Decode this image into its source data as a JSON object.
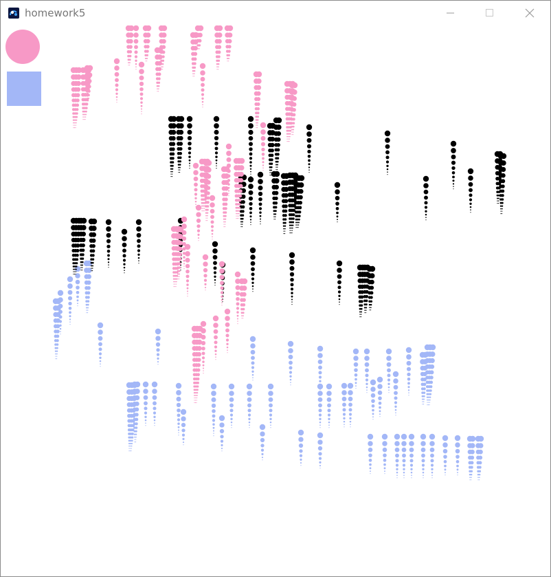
{
  "window": {
    "title": "homework5",
    "icon": "processing-app-icon",
    "controls": [
      "minimize-icon",
      "maximize-icon",
      "close-icon"
    ]
  },
  "palette": {
    "pink": "#f799c6",
    "blue": "#a3b7f7",
    "black": "#000000",
    "background": "#ffffff",
    "ui_gray": "#9a9a9a"
  },
  "sketch": {
    "pink_drips": [
      [
        186,
        40,
        9,
        1
      ],
      [
        197,
        40,
        10,
        0
      ],
      [
        211,
        40,
        8,
        1
      ],
      [
        234,
        40,
        10,
        1
      ],
      [
        287,
        40,
        5,
        1
      ],
      [
        315,
        40,
        10,
        1
      ],
      [
        330,
        40,
        8,
        1
      ],
      [
        280,
        50,
        10,
        1
      ],
      [
        228,
        72,
        10,
        1
      ],
      [
        169,
        88,
        10,
        0
      ],
      [
        106,
        101,
        14,
        2
      ],
      [
        120,
        101,
        12,
        2
      ],
      [
        126,
        98,
        8,
        1
      ],
      [
        205,
        93,
        12,
        0
      ],
      [
        294,
        95,
        10,
        0
      ],
      [
        372,
        107,
        13,
        1
      ],
      [
        417,
        121,
        14,
        2
      ],
      [
        424,
        123,
        12,
        1
      ],
      [
        382,
        181,
        11,
        0
      ],
      [
        332,
        212,
        12,
        0
      ],
      [
        343,
        233,
        14,
        2
      ],
      [
        293,
        234,
        12,
        2
      ],
      [
        299,
        236,
        14,
        1
      ],
      [
        284,
        240,
        10,
        0
      ],
      [
        325,
        245,
        14,
        1
      ],
      [
        308,
        287,
        10,
        0
      ],
      [
        288,
        301,
        8,
        0
      ],
      [
        267,
        318,
        12,
        0
      ],
      [
        252,
        332,
        14,
        2
      ],
      [
        258,
        333,
        12,
        1
      ],
      [
        272,
        358,
        12,
        0
      ],
      [
        298,
        373,
        8,
        0
      ],
      [
        322,
        383,
        10,
        0
      ],
      [
        345,
        398,
        12,
        0
      ],
      [
        351,
        408,
        9,
        1
      ],
      [
        330,
        452,
        10,
        0
      ],
      [
        313,
        462,
        10,
        0
      ],
      [
        295,
        470,
        12,
        0
      ],
      [
        282,
        477,
        18,
        2
      ]
    ],
    "black_drips": [
      [
        248,
        172,
        14,
        1
      ],
      [
        259,
        172,
        13,
        1
      ],
      [
        275,
        172,
        12,
        0
      ],
      [
        314,
        172,
        12,
        0
      ],
      [
        364,
        172,
        14,
        0
      ],
      [
        392,
        182,
        12,
        1
      ],
      [
        401,
        174,
        12,
        1
      ],
      [
        449,
        184,
        11,
        0
      ],
      [
        563,
        193,
        10,
        0
      ],
      [
        659,
        208,
        11,
        0
      ],
      [
        723,
        223,
        12,
        1
      ],
      [
        728,
        226,
        14,
        1
      ],
      [
        684,
        248,
        10,
        0
      ],
      [
        350,
        257,
        12,
        1
      ],
      [
        364,
        260,
        11,
        0
      ],
      [
        378,
        253,
        12,
        0
      ],
      [
        398,
        252,
        11,
        1
      ],
      [
        412,
        255,
        14,
        1
      ],
      [
        421,
        254,
        14,
        2
      ],
      [
        430,
        258,
        12,
        2
      ],
      [
        619,
        259,
        10,
        0
      ],
      [
        490,
        268,
        9,
        0
      ],
      [
        106,
        320,
        13,
        2
      ],
      [
        117,
        320,
        12,
        1
      ],
      [
        132,
        321,
        12,
        1
      ],
      [
        157,
        322,
        11,
        0
      ],
      [
        180,
        336,
        10,
        0
      ],
      [
        201,
        322,
        10,
        0
      ],
      [
        262,
        320,
        12,
        0
      ],
      [
        312,
        354,
        10,
        0
      ],
      [
        323,
        384,
        9,
        0
      ],
      [
        367,
        363,
        10,
        0
      ],
      [
        424,
        370,
        12,
        0
      ],
      [
        493,
        382,
        10,
        0
      ],
      [
        523,
        388,
        12,
        1
      ],
      [
        530,
        388,
        11,
        1
      ],
      [
        537,
        390,
        10,
        1
      ]
    ],
    "blue_drips": [
      [
        125,
        382,
        12,
        1
      ],
      [
        112,
        390,
        9,
        0
      ],
      [
        101,
        405,
        11,
        0
      ],
      [
        87,
        425,
        10,
        0
      ],
      [
        80,
        437,
        14,
        1
      ],
      [
        145,
        472,
        10,
        0
      ],
      [
        229,
        481,
        8,
        0
      ],
      [
        367,
        492,
        10,
        0
      ],
      [
        422,
        499,
        10,
        0
      ],
      [
        465,
        506,
        10,
        0
      ],
      [
        517,
        510,
        9,
        0
      ],
      [
        533,
        510,
        10,
        0
      ],
      [
        565,
        510,
        10,
        0
      ],
      [
        594,
        508,
        11,
        0
      ],
      [
        621,
        504,
        14,
        2
      ],
      [
        614,
        515,
        12,
        1
      ],
      [
        552,
        551,
        9,
        0
      ],
      [
        542,
        555,
        9,
        0
      ],
      [
        575,
        543,
        10,
        0
      ],
      [
        187,
        559,
        16,
        2
      ],
      [
        195,
        558,
        14,
        1
      ],
      [
        211,
        558,
        10,
        0
      ],
      [
        224,
        558,
        10,
        0
      ],
      [
        259,
        560,
        12,
        0
      ],
      [
        310,
        561,
        12,
        0
      ],
      [
        336,
        561,
        10,
        0
      ],
      [
        362,
        561,
        10,
        0
      ],
      [
        393,
        561,
        10,
        0
      ],
      [
        465,
        561,
        10,
        0
      ],
      [
        478,
        561,
        10,
        0
      ],
      [
        500,
        560,
        10,
        0
      ],
      [
        509,
        560,
        10,
        0
      ],
      [
        266,
        598,
        8,
        0
      ],
      [
        322,
        607,
        8,
        0
      ],
      [
        381,
        620,
        8,
        0
      ],
      [
        437,
        628,
        8,
        0
      ],
      [
        465,
        632,
        8,
        0
      ],
      [
        538,
        634,
        9,
        0
      ],
      [
        559,
        634,
        9,
        0
      ],
      [
        577,
        634,
        10,
        0
      ],
      [
        587,
        634,
        10,
        0
      ],
      [
        598,
        634,
        10,
        0
      ],
      [
        615,
        634,
        10,
        0
      ],
      [
        628,
        634,
        10,
        0
      ],
      [
        647,
        636,
        9,
        0
      ],
      [
        665,
        636,
        9,
        0
      ],
      [
        683,
        637,
        10,
        1
      ],
      [
        695,
        637,
        10,
        1
      ]
    ]
  }
}
